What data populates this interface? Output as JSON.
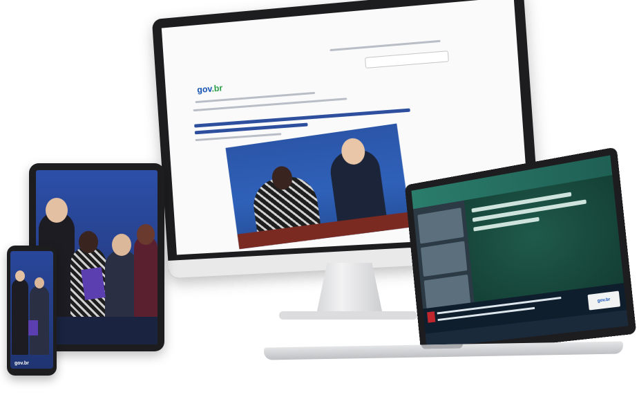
{
  "desktop": {
    "logo": {
      "text_main": "gov",
      "text_accent": ".br"
    },
    "headline": ""
  },
  "tablet": {
    "caption": ""
  },
  "phone": {
    "caption": "",
    "logo": "gov.br"
  },
  "laptop": {
    "title": "",
    "subtitle": "",
    "lower_third": "",
    "badge": "gov.br"
  },
  "colors": {
    "gov_blue": "#1351b4",
    "gov_green": "#2c9f47",
    "banner_yellow": "#f5d000",
    "stage_blue": "#2b56a8",
    "forest_green": "#1f5a4a"
  }
}
